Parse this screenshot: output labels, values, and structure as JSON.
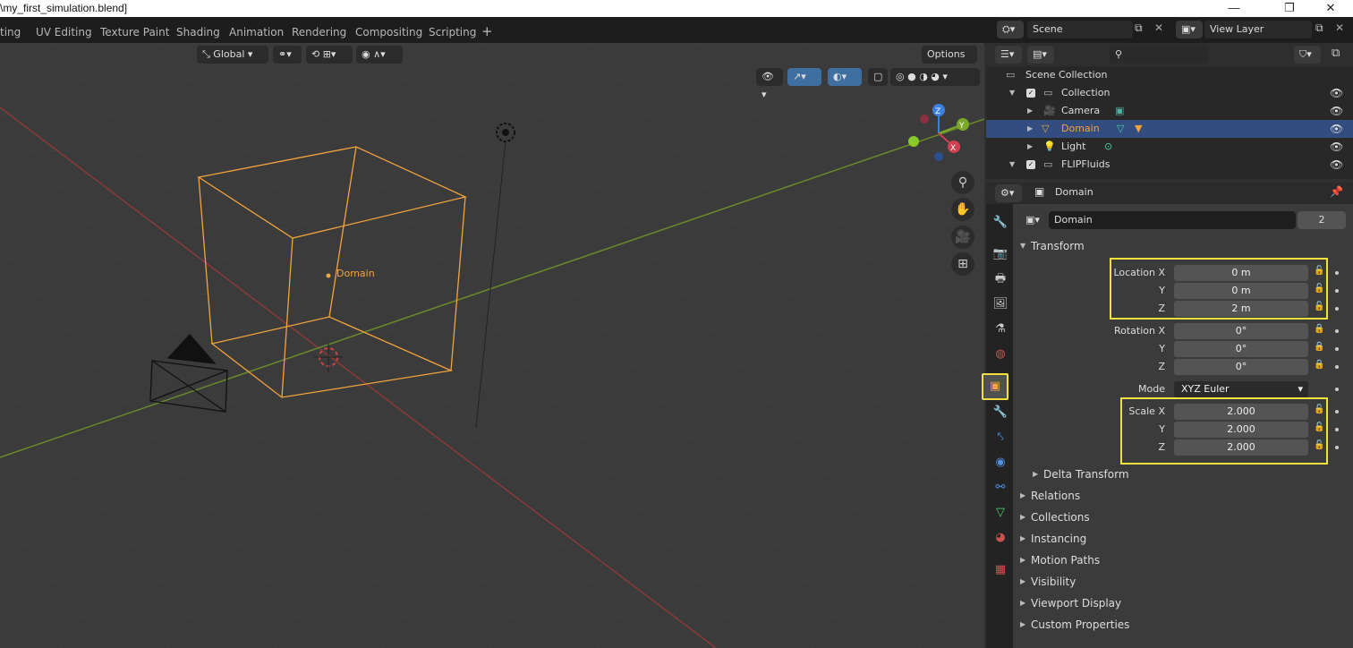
{
  "window": {
    "title": "\\my_first_simulation.blend]",
    "minimize": "—",
    "maximize": "❐",
    "close": "✕"
  },
  "workspaces": [
    "ting",
    "UV Editing",
    "Texture Paint",
    "Shading",
    "Animation",
    "Rendering",
    "Compositing",
    "Scripting"
  ],
  "workspace_add": "+",
  "scene": {
    "scene_name": "Scene",
    "view_layer": "View Layer"
  },
  "viewport": {
    "orientation": "Global",
    "options": "Options",
    "domain_label": "Domain",
    "gizmo": {
      "z": "Z",
      "y": "Y",
      "x": "X"
    }
  },
  "outliner": {
    "scene_collection": "Scene Collection",
    "items": [
      {
        "label": "Collection",
        "type": "collection"
      },
      {
        "label": "Camera",
        "type": "camera"
      },
      {
        "label": "Domain",
        "type": "mesh",
        "selected": true
      },
      {
        "label": "Light",
        "type": "light"
      },
      {
        "label": "FLIPFluids",
        "type": "collection"
      }
    ]
  },
  "properties": {
    "context": "Domain",
    "object_name": "Domain",
    "users": "2",
    "transform_header": "Transform",
    "location": {
      "label_x": "Location X",
      "label_y": "Y",
      "label_z": "Z",
      "x": "0 m",
      "y": "0 m",
      "z": "2 m"
    },
    "rotation": {
      "label_x": "Rotation X",
      "label_y": "Y",
      "label_z": "Z",
      "x": "0°",
      "y": "0°",
      "z": "0°"
    },
    "mode": {
      "label": "Mode",
      "value": "XYZ Euler"
    },
    "scale": {
      "label_x": "Scale X",
      "label_y": "Y",
      "label_z": "Z",
      "x": "2.000",
      "y": "2.000",
      "z": "2.000"
    },
    "delta_transform": "Delta Transform",
    "sections": [
      "Relations",
      "Collections",
      "Instancing",
      "Motion Paths",
      "Visibility",
      "Viewport Display",
      "Custom Properties"
    ]
  },
  "colors": {
    "accent_orange": "#f3a33d",
    "highlight_yellow": "#f0e040",
    "selection_blue": "#334d80"
  }
}
